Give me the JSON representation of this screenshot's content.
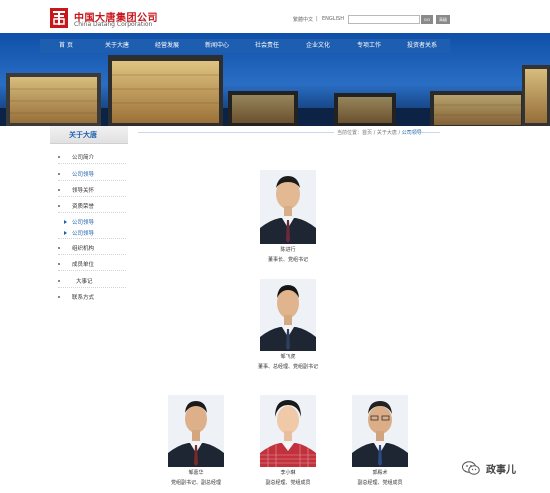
{
  "header": {
    "logo_cn": "中国大唐集团公司",
    "logo_en": "China Datang Corporation",
    "lang_cn": "繁體中文",
    "lang_sep": "|",
    "lang_en": "ENGLISH",
    "search_value": "",
    "search_button": "GO",
    "advanced_button": "高级",
    "brand_color": "#c8161d"
  },
  "nav": {
    "items": [
      "首 页",
      "关于大唐",
      "经营发展",
      "新闻中心",
      "社会责任",
      "企业文化",
      "专项工作",
      "投资者关系"
    ],
    "bar_color": "#1f5fb0"
  },
  "sidebar": {
    "title": "关于大唐",
    "items": [
      "公司简介",
      "公司领导",
      "领导关怀",
      "资质荣誉",
      "公司领导",
      "公司领导",
      "组织机构",
      "成员单位",
      "大事记",
      "联系方式"
    ]
  },
  "breadcrumb": {
    "prefix": "当前位置：",
    "home": "首页",
    "sep": " / ",
    "section": "关于大唐",
    "current": "公司领导"
  },
  "leaders": [
    {
      "name": "陈进行",
      "title": "董事长、党组书记"
    },
    {
      "name": "邹飞虎",
      "title": "董事、总经理、党组副书记"
    },
    {
      "name": "邹嘉华",
      "title": "党组副书记、副总经理"
    },
    {
      "name": "李小琳",
      "title": "副总经理、党组成员"
    },
    {
      "name": "郭殿术",
      "title": "副总经理、党组成员"
    }
  ],
  "watermark": {
    "text": "政事儿",
    "icon": "wechat-icon"
  }
}
